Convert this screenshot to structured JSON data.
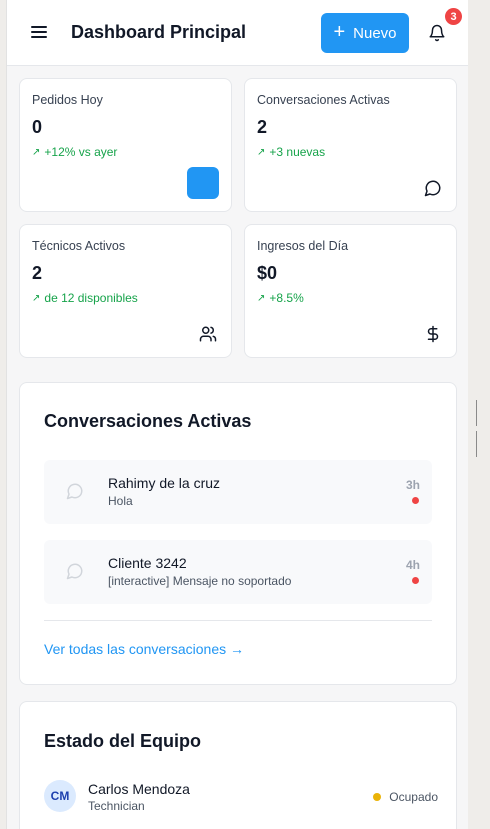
{
  "header": {
    "title": "Dashboard Principal",
    "new_button_label": "Nuevo",
    "notification_count": "3"
  },
  "stats": [
    {
      "label": "Pedidos Hoy",
      "value": "0",
      "change": "+12% vs ayer",
      "icon": "blue-square"
    },
    {
      "label": "Conversaciones Activas",
      "value": "2",
      "change": "+3 nuevas",
      "icon": "chat-icon"
    },
    {
      "label": "Técnicos Activos",
      "value": "2",
      "change": "de 12 disponibles",
      "icon": "users-icon"
    },
    {
      "label": "Ingresos del Día",
      "value": "$0",
      "change": "+8.5%",
      "icon": "dollar-icon"
    }
  ],
  "trend_icon": "↗",
  "conversations": {
    "title": "Conversaciones Activas",
    "items": [
      {
        "name": "Rahimy de la cruz",
        "message": "Hola",
        "time": "3h"
      },
      {
        "name": "Cliente 3242",
        "message": "[interactive] Mensaje no soportado",
        "time": "4h"
      }
    ],
    "view_all_label": "Ver todas las conversaciones →"
  },
  "team": {
    "title": "Estado del Equipo",
    "members": [
      {
        "initials": "CM",
        "name": "Carlos Mendoza",
        "role": "Technician",
        "status": "Ocupado"
      }
    ]
  },
  "colors": {
    "accent": "#2196f3",
    "success": "#16a34a",
    "alert": "#ef4444",
    "busy": "#eab308"
  }
}
